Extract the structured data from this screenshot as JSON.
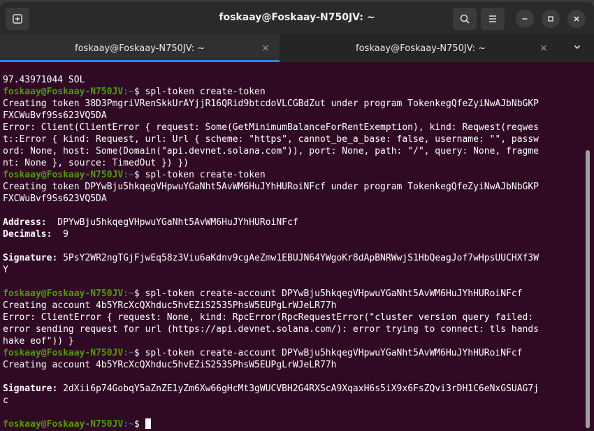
{
  "window": {
    "title": "foskaay@Foskaay-N750JV: ~"
  },
  "tabs": [
    {
      "label": "foskaay@Foskaay-N750JV: ~",
      "close": "×"
    },
    {
      "label": "foskaay@Foskaay-N750JV: ~",
      "close": "×"
    }
  ],
  "terminal": {
    "prompt_user": "foskaay@Foskaay-N750JV",
    "prompt_path": ":~",
    "prompt_sign": "$ ",
    "lines": {
      "l0": "97.43971044 SOL",
      "cmd1": "spl-token create-token",
      "l2": "Creating token 38D3PmgriVRenSkkUrAYjjR16QRid9btcdoVLCGBdZut under program TokenkegQfeZyiNwAJbNbGKP",
      "l3": "FXCWuBvf9Ss623VQ5DA",
      "l4": "Error: Client(ClientError { request: Some(GetMinimumBalanceForRentExemption), kind: Reqwest(reqwes",
      "l5": "t::Error { kind: Request, url: Url { scheme: \"https\", cannot_be_a_base: false, username: \"\", passw",
      "l6": "ord: None, host: Some(Domain(\"api.devnet.solana.com\")), port: None, path: \"/\", query: None, fragme",
      "l7": "nt: None }, source: TimedOut }) })",
      "cmd2": "spl-token create-token",
      "l9": "Creating token DPYwBju5hkqegVHpwuYGaNht5AvWM6HuJYhHURoiNFcf under program TokenkegQfeZyiNwAJbNbGKP",
      "l10": "FXCWuBvf9Ss623VQ5DA",
      "addr_label": "Address:",
      "addr_value": "  DPYwBju5hkqegVHpwuYGaNht5AvWM6HuJYhHURoiNFcf",
      "dec_label": "Decimals:",
      "dec_value": "  9",
      "sig1_label": "Signature:",
      "sig1_value": " 5PsY2WR2ngTGjFjwEq58z3Viu6aKdnv9cgAeZmw1EBUJN64YWgoKr8dApBNRWwjS1HbQeagJof7wHpsUUCHXf3W",
      "l17": "Y",
      "cmd3": "spl-token create-account DPYwBju5hkqegVHpwuYGaNht5AvWM6HuJYhHURoiNFcf",
      "l20": "Creating account 4b5YRcXcQXhduc5hvEZiS2535PhsW5EUPgLrWJeLR77h",
      "l21": "Error: ClientError { request: None, kind: RpcError(RpcRequestError(\"cluster version query failed:",
      "l22": "error sending request for url (https://api.devnet.solana.com/): error trying to connect: tls hands",
      "l23": "hake eof\")) }",
      "cmd4": "spl-token create-account DPYwBju5hkqegVHpwuYGaNht5AvWM6HuJYhHURoiNFcf",
      "l25": "Creating account 4b5YRcXcQXhduc5hvEZiS2535PhsW5EUPgLrWJeLR77h",
      "sig2_label": "Signature:",
      "sig2_value": " 2dXii6p74GobqY5aZnZE1yZm6Xw66gHcMt3gWUCVBH2G4RXScA9XqaxH6s5iX9x6FsZQvi3rDH1C6eNxGSUAG7j",
      "l28": "c"
    }
  }
}
